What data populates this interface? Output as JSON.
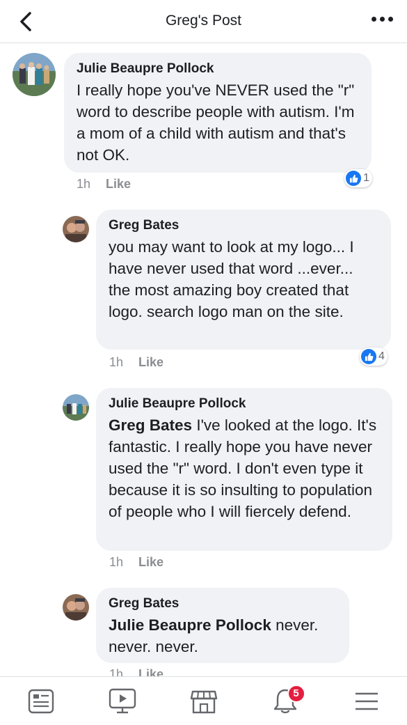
{
  "header": {
    "title": "Greg's Post",
    "back_icon": "chevron-left-icon",
    "more_icon": "ellipsis-icon"
  },
  "comments": [
    {
      "author": "Julie Beaupre Pollock",
      "mention": "",
      "text": "I really hope you've NEVER used the \"r\" word to describe  people with autism.  I'm a mom of a child with autism and that's not OK.",
      "time": "1h",
      "like_label": "Like",
      "reaction_count": "1"
    },
    {
      "author": "Greg Bates",
      "mention": "",
      "text": "you may want to look at my logo... I have never used that word ...ever... the most amazing boy created that logo. search logo man on the site.",
      "time": "1h",
      "like_label": "Like",
      "reaction_count": "4"
    },
    {
      "author": "Julie Beaupre Pollock",
      "mention": "Greg Bates",
      "text": " I've looked at the logo. It's fantastic. I really hope you have never used the \"r\" word. I don't even type it because it is so insulting to population of people who I will fiercely defend.",
      "time": "1h",
      "like_label": "Like",
      "reaction_count": ""
    },
    {
      "author": "Greg Bates",
      "mention": "Julie Beaupre Pollock",
      "text": " never. never. never.",
      "time": "1h",
      "like_label": "Like",
      "reaction_count": ""
    }
  ],
  "bottom_nav": {
    "items": [
      {
        "icon": "news-feed-icon"
      },
      {
        "icon": "watch-video-icon"
      },
      {
        "icon": "marketplace-icon"
      },
      {
        "icon": "notifications-bell-icon",
        "badge": "5"
      },
      {
        "icon": "menu-icon"
      }
    ]
  },
  "colors": {
    "bubble": "#f0f2f5",
    "like_blue": "#1877f2",
    "badge_red": "#e41e3f",
    "meta_gray": "#8a8d91"
  }
}
